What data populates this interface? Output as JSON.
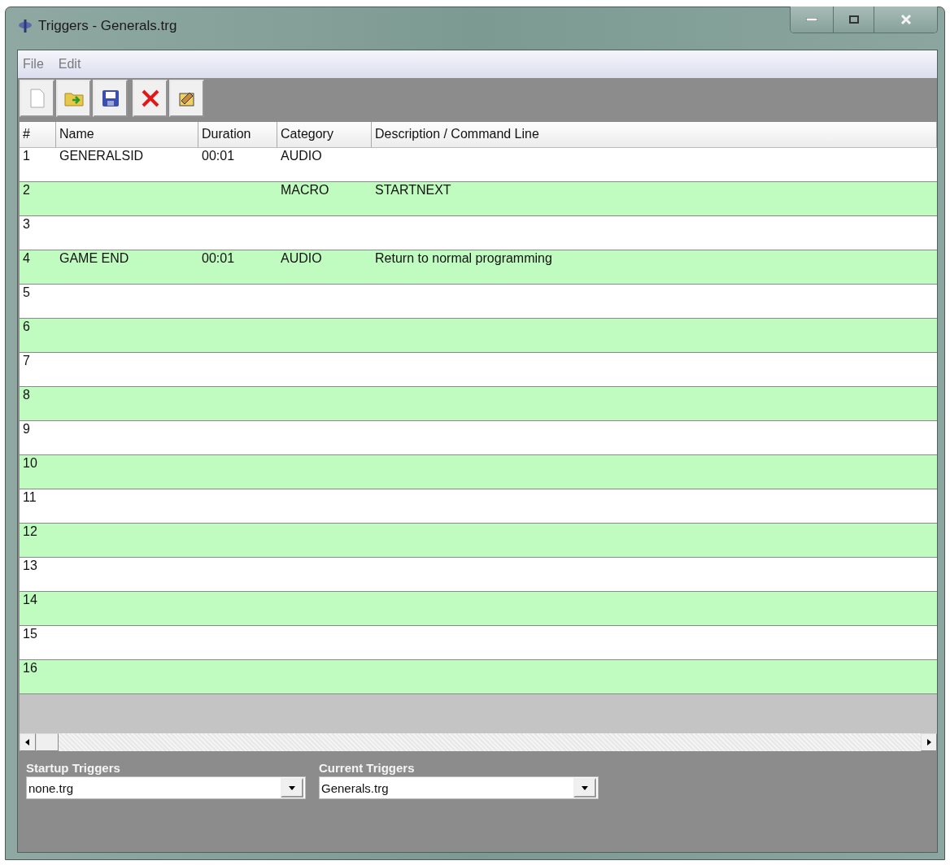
{
  "window": {
    "title": "Triggers - Generals.trg"
  },
  "menu": [
    "File",
    "Edit"
  ],
  "toolbar": [
    {
      "kind": "new"
    },
    {
      "kind": "open"
    },
    {
      "kind": "save"
    },
    {
      "kind": "delete"
    },
    {
      "kind": "edit"
    }
  ],
  "table": {
    "columns": [
      "#",
      "Name",
      "Duration",
      "Category",
      "Description / Command Line"
    ],
    "rows": [
      {
        "number": "1",
        "name": "GENERALSID",
        "duration": "00:01",
        "category": "AUDIO",
        "description": ""
      },
      {
        "number": "2",
        "name": "",
        "duration": "",
        "category": "MACRO",
        "description": "STARTNEXT"
      },
      {
        "number": "3",
        "name": "",
        "duration": "",
        "category": "",
        "description": ""
      },
      {
        "number": "4",
        "name": "GAME END",
        "duration": "00:01",
        "category": "AUDIO",
        "description": "Return to normal programming"
      },
      {
        "number": "5"
      },
      {
        "number": "6"
      },
      {
        "number": "7"
      },
      {
        "number": "8"
      },
      {
        "number": "9"
      },
      {
        "number": "10"
      },
      {
        "number": "11"
      },
      {
        "number": "12"
      },
      {
        "number": "13"
      },
      {
        "number": "14"
      },
      {
        "number": "15"
      },
      {
        "number": "16"
      }
    ]
  },
  "startup": {
    "label": "Startup Triggers",
    "value": "none.trg"
  },
  "current": {
    "label": "Current Triggers",
    "value": "Generals.trg"
  }
}
